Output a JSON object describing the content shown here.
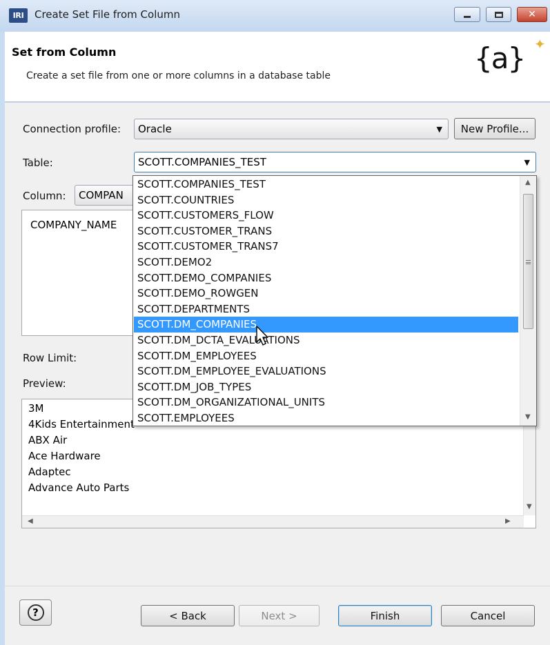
{
  "window": {
    "title": "Create Set File from Column",
    "app_icon": "IRI"
  },
  "header": {
    "title": "Set from Column",
    "description": "Create a set file from one or more columns in a database table",
    "logo": "{a}"
  },
  "form": {
    "connection_profile_label": "Connection profile:",
    "connection_profile_value": "Oracle",
    "new_profile_label": "New Profile...",
    "table_label": "Table:",
    "table_value": "SCOTT.COMPANIES_TEST",
    "column_label": "Column:",
    "column_value": "COMPAN",
    "column_list": [
      "COMPANY_NAME"
    ],
    "row_limit_label": "Row Limit:",
    "preview_label": "Preview:"
  },
  "preview_rows": [
    "3M",
    "4Kids Entertainment",
    "ABX Air",
    "Ace Hardware",
    "Adaptec",
    "Advance Auto Parts"
  ],
  "dropdown": {
    "items": [
      "SCOTT.COMPANIES_TEST",
      "SCOTT.COUNTRIES",
      "SCOTT.CUSTOMERS_FLOW",
      "SCOTT.CUSTOMER_TRANS",
      "SCOTT.CUSTOMER_TRANS7",
      "SCOTT.DEMO2",
      "SCOTT.DEMO_COMPANIES",
      "SCOTT.DEMO_ROWGEN",
      "SCOTT.DEPARTMENTS",
      "SCOTT.DM_COMPANIES",
      "SCOTT.DM_DCTA_EVALUATIONS",
      "SCOTT.DM_EMPLOYEES",
      "SCOTT.DM_EMPLOYEE_EVALUATIONS",
      "SCOTT.DM_JOB_TYPES",
      "SCOTT.DM_ORGANIZATIONAL_UNITS",
      "SCOTT.EMPLOYEES"
    ],
    "selected": "SCOTT.DM_COMPANIES"
  },
  "buttons": {
    "back": "< Back",
    "next": "Next >",
    "finish": "Finish",
    "cancel": "Cancel",
    "help": "?"
  },
  "colors": {
    "selection": "#3399ff",
    "title_bar": "#c8dcf2",
    "close_button": "#c5422c"
  }
}
